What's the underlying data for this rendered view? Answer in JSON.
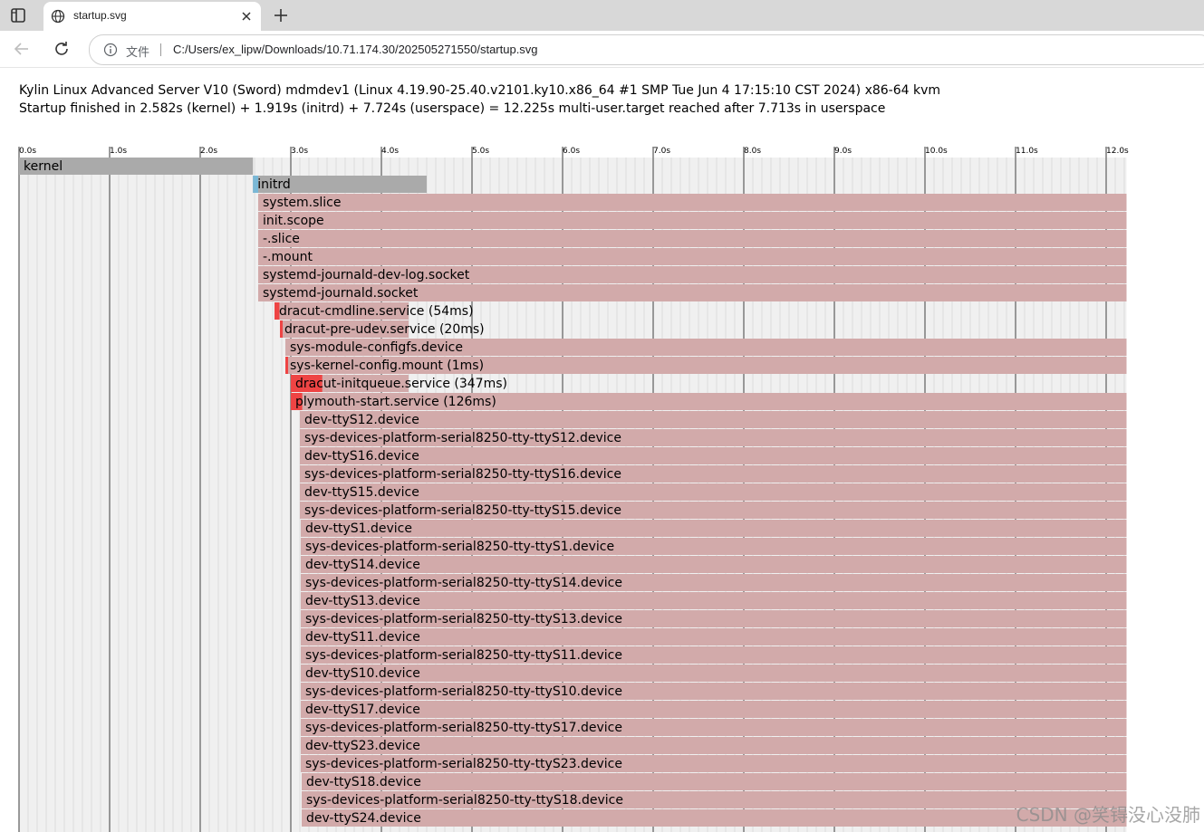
{
  "browser": {
    "tab_title": "startup.svg",
    "scheme_label": "文件",
    "url": "C:/Users/ex_lipw/Downloads/10.71.174.30/202505271550/startup.svg"
  },
  "header": {
    "line1": "Kylin Linux Advanced Server V10 (Sword) mdmdev1 (Linux 4.19.90-25.40.v2101.ky10.x86_64 #1 SMP Tue Jun 4 17:15:10 CST 2024) x86-64 kvm",
    "line2": "Startup finished in 2.582s (kernel) + 1.919s (initrd) + 7.724s (userspace) = 12.225s multi-user.target reached after 7.713s in userspace"
  },
  "watermark": "CSDN @笑锝没心没肺",
  "colors": {
    "kernel": "#aaaaaa",
    "initrd": "#aaaaaa",
    "initrd_active": "#7ab8d6",
    "unit_active": "#d2aaaa",
    "unit_activating": "#ee4444",
    "grid_bg": "#f0f0f0",
    "grid_major": "#7a7a7a",
    "grid_minor": "#dcdcdc"
  },
  "chart_data": {
    "type": "timeline",
    "x_unit": "s",
    "x_ticks": [
      "0.0s",
      "1.0s",
      "2.0s",
      "3.0s",
      "4.0s",
      "5.0s",
      "6.0s",
      "7.0s",
      "8.0s",
      "9.0s",
      "10.0s",
      "11.0s",
      "12.0s"
    ],
    "xlim": [
      0,
      12.225
    ],
    "rows": [
      {
        "label": "kernel",
        "start": 0.0,
        "end": 2.582,
        "kind": "kernel"
      },
      {
        "label": "initrd",
        "start": 2.582,
        "end": 4.5,
        "kind": "initrd",
        "active_start": 2.582,
        "active_end": 2.64
      },
      {
        "label": "system.slice",
        "start": 2.64,
        "end": 12.225,
        "kind": "unit"
      },
      {
        "label": "init.scope",
        "start": 2.64,
        "end": 12.225,
        "kind": "unit"
      },
      {
        "label": "-.slice",
        "start": 2.64,
        "end": 12.225,
        "kind": "unit"
      },
      {
        "label": "-.mount",
        "start": 2.64,
        "end": 12.225,
        "kind": "unit"
      },
      {
        "label": "systemd-journald-dev-log.socket",
        "start": 2.64,
        "end": 12.225,
        "kind": "unit"
      },
      {
        "label": "systemd-journald.socket",
        "start": 2.64,
        "end": 12.225,
        "kind": "unit"
      },
      {
        "label": "dracut-cmdline.service (54ms)",
        "start": 2.82,
        "end": 4.3,
        "kind": "service",
        "activating": 0.054
      },
      {
        "label": "dracut-pre-udev.service (20ms)",
        "start": 2.88,
        "end": 4.3,
        "kind": "service",
        "activating": 0.02
      },
      {
        "label": "sys-module-configfs.device",
        "start": 2.94,
        "end": 12.225,
        "kind": "unit"
      },
      {
        "label": "sys-kernel-config.mount (1ms)",
        "start": 2.94,
        "end": 12.225,
        "kind": "unit",
        "activating": 0.001
      },
      {
        "label": "dracut-initqueue.service (347ms)",
        "start": 3.0,
        "end": 4.3,
        "kind": "service",
        "activating": 0.347
      },
      {
        "label": "plymouth-start.service (126ms)",
        "start": 3.0,
        "end": 12.225,
        "kind": "unit",
        "activating": 0.126
      },
      {
        "label": "dev-ttyS12.device",
        "start": 3.1,
        "end": 12.225,
        "kind": "unit"
      },
      {
        "label": "sys-devices-platform-serial8250-tty-ttyS12.device",
        "start": 3.1,
        "end": 12.225,
        "kind": "unit"
      },
      {
        "label": "dev-ttyS16.device",
        "start": 3.1,
        "end": 12.225,
        "kind": "unit"
      },
      {
        "label": "sys-devices-platform-serial8250-tty-ttyS16.device",
        "start": 3.1,
        "end": 12.225,
        "kind": "unit"
      },
      {
        "label": "dev-ttyS15.device",
        "start": 3.1,
        "end": 12.225,
        "kind": "unit"
      },
      {
        "label": "sys-devices-platform-serial8250-tty-ttyS15.device",
        "start": 3.1,
        "end": 12.225,
        "kind": "unit"
      },
      {
        "label": "dev-ttyS1.device",
        "start": 3.11,
        "end": 12.225,
        "kind": "unit"
      },
      {
        "label": "sys-devices-platform-serial8250-tty-ttyS1.device",
        "start": 3.11,
        "end": 12.225,
        "kind": "unit"
      },
      {
        "label": "dev-ttyS14.device",
        "start": 3.11,
        "end": 12.225,
        "kind": "unit"
      },
      {
        "label": "sys-devices-platform-serial8250-tty-ttyS14.device",
        "start": 3.11,
        "end": 12.225,
        "kind": "unit"
      },
      {
        "label": "dev-ttyS13.device",
        "start": 3.11,
        "end": 12.225,
        "kind": "unit"
      },
      {
        "label": "sys-devices-platform-serial8250-tty-ttyS13.device",
        "start": 3.11,
        "end": 12.225,
        "kind": "unit"
      },
      {
        "label": "dev-ttyS11.device",
        "start": 3.11,
        "end": 12.225,
        "kind": "unit"
      },
      {
        "label": "sys-devices-platform-serial8250-tty-ttyS11.device",
        "start": 3.11,
        "end": 12.225,
        "kind": "unit"
      },
      {
        "label": "dev-ttyS10.device",
        "start": 3.11,
        "end": 12.225,
        "kind": "unit"
      },
      {
        "label": "sys-devices-platform-serial8250-tty-ttyS10.device",
        "start": 3.11,
        "end": 12.225,
        "kind": "unit"
      },
      {
        "label": "dev-ttyS17.device",
        "start": 3.11,
        "end": 12.225,
        "kind": "unit"
      },
      {
        "label": "sys-devices-platform-serial8250-tty-ttyS17.device",
        "start": 3.11,
        "end": 12.225,
        "kind": "unit"
      },
      {
        "label": "dev-ttyS23.device",
        "start": 3.11,
        "end": 12.225,
        "kind": "unit"
      },
      {
        "label": "sys-devices-platform-serial8250-tty-ttyS23.device",
        "start": 3.11,
        "end": 12.225,
        "kind": "unit"
      },
      {
        "label": "dev-ttyS18.device",
        "start": 3.12,
        "end": 12.225,
        "kind": "unit"
      },
      {
        "label": "sys-devices-platform-serial8250-tty-ttyS18.device",
        "start": 3.12,
        "end": 12.225,
        "kind": "unit"
      },
      {
        "label": "dev-ttyS24.device",
        "start": 3.12,
        "end": 12.225,
        "kind": "unit"
      }
    ]
  }
}
